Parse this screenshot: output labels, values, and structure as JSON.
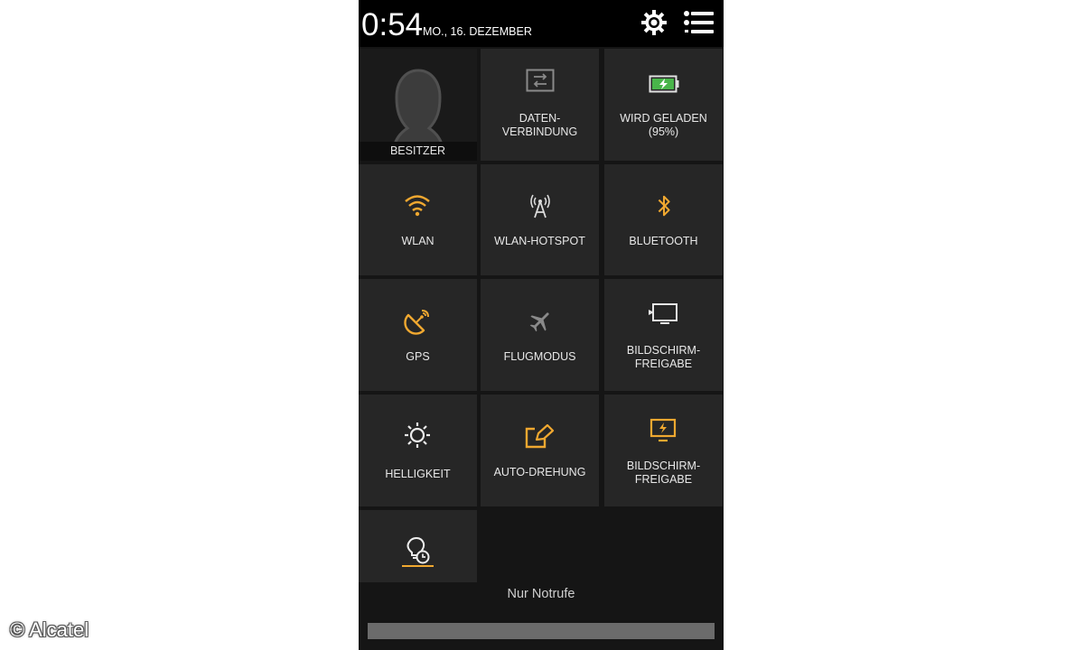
{
  "status": {
    "time": "0:54",
    "date": "MO., 16. DEZEMBER"
  },
  "tiles": {
    "owner": "BESITZER",
    "data_line1": "DATEN-",
    "data_line2": "VERBINDUNG",
    "charging_line1": "WIRD GELADEN",
    "charging_line2": "(95%)",
    "wlan": "WLAN",
    "hotspot": "WLAN-HOTSPOT",
    "bluetooth": "BLUETOOTH",
    "gps": "GPS",
    "flight": "FLUGMODUS",
    "share1_line1": "BILDSCHIRM-",
    "share1_line2": "FREIGABE",
    "brightness": "HELLIGKEIT",
    "rotation": "AUTO-DREHUNG",
    "share2_line1": "BILDSCHIRM-",
    "share2_line2": "FREIGABE"
  },
  "footer": {
    "emergency": "Nur Notrufe"
  },
  "watermark": "© Alcatel",
  "colors": {
    "accent": "#f0a830",
    "tile": "#262626",
    "background": "#151515"
  },
  "icons": {
    "settings": "gear-icon",
    "menu": "list-icon",
    "owner": "person-icon",
    "data": "data-transfer-icon",
    "charging": "battery-icon",
    "wlan": "wifi-icon",
    "hotspot": "hotspot-icon",
    "bluetooth": "bluetooth-icon",
    "gps": "satellite-icon",
    "flight": "airplane-icon",
    "share": "cast-screen-icon",
    "brightness": "sun-icon",
    "rotation": "rotate-icon",
    "bulb": "lightbulb-timer-icon"
  }
}
